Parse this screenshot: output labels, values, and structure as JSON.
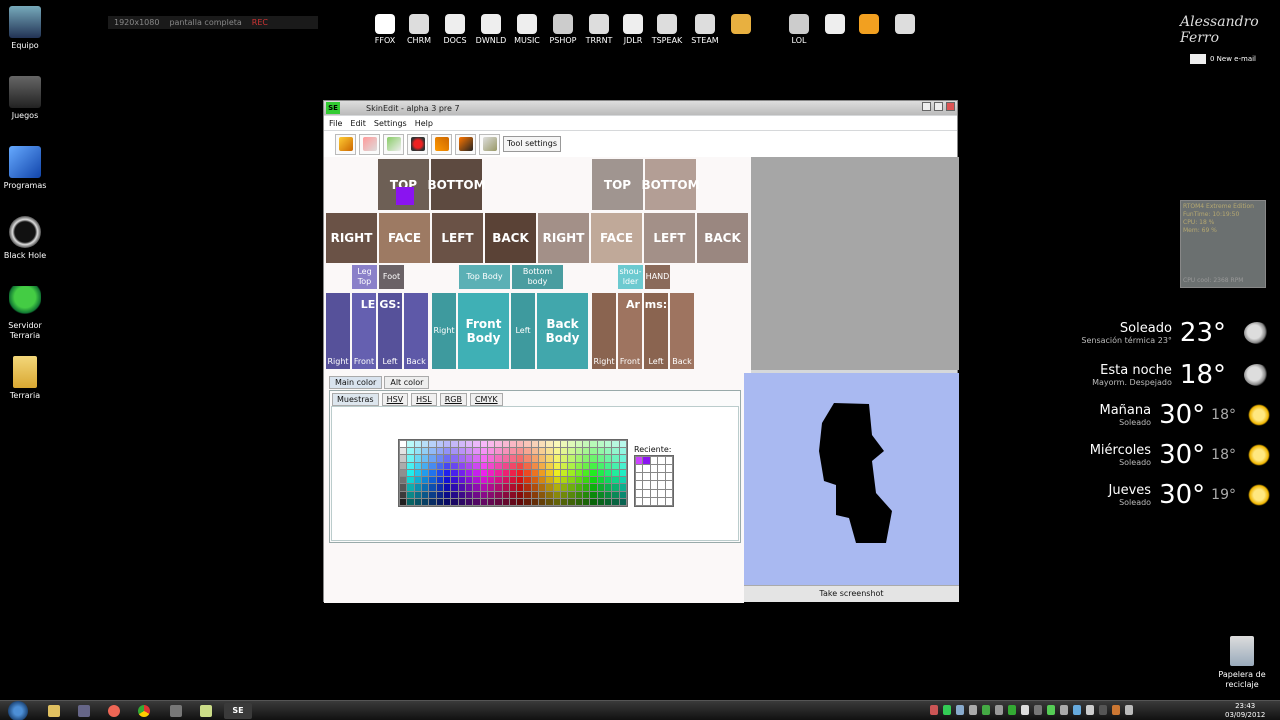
{
  "desktop_icons": [
    {
      "label": "Equipo"
    },
    {
      "label": "Juegos"
    },
    {
      "label": "Programas"
    },
    {
      "label": "Black Hole"
    },
    {
      "label": "Servidor Terraria"
    },
    {
      "label": "Terraria"
    }
  ],
  "recording_bar": {
    "resolution": "1920x1080",
    "mode": "pantalla completa",
    "rec": "REC"
  },
  "launcher": [
    "FFOX",
    "CHRM",
    "DOCS",
    "DWNLD",
    "MUSIC",
    "PSHOP",
    "TRRNT",
    "JDLR",
    "TSPEAK",
    "STEAM",
    "",
    "LOL",
    "",
    "",
    ""
  ],
  "signature": "Alessandro Ferro",
  "mail": "0 New e-mail",
  "cpu_widget": {
    "lines": [
      "RTOM4 Extreme Edition",
      "FunTime: 10:19:50",
      "CPU: 18 %",
      "Mem: 69 %"
    ],
    "fan": "CPU cool: 2368 RPM"
  },
  "weather": [
    {
      "name": "Soleado",
      "sub": "Sensación térmica 23°",
      "temp": "23°",
      "low": "",
      "icon": "moon-cloud-icon"
    },
    {
      "name": "Esta noche",
      "sub": "Mayorm. Despejado",
      "temp": "18°",
      "low": "",
      "icon": "moon-cloud-icon"
    },
    {
      "name": "Mañana",
      "sub": "Soleado",
      "temp": "30°",
      "low": "18°",
      "icon": "sun-icon"
    },
    {
      "name": "Miércoles",
      "sub": "Soleado",
      "temp": "30°",
      "low": "18°",
      "icon": "sun-icon"
    },
    {
      "name": "Jueves",
      "sub": "Soleado",
      "temp": "30°",
      "low": "19°",
      "icon": "sun-icon"
    }
  ],
  "recycle_bin": "Papelera de reciclaje",
  "taskbar": {
    "se_label": "SE",
    "clock_time": "23:43",
    "clock_date": "03/09/2012"
  },
  "window": {
    "logo": "SE",
    "title": "SkinEdit - alpha 3 pre 7",
    "menu": [
      "File",
      "Edit",
      "Settings",
      "Help"
    ],
    "tool_settings": "Tool settings",
    "parts": {
      "top1": "TOP",
      "bottom1": "BOTTOM",
      "top2": "TOP",
      "bottom2": "BOTTOM",
      "right1": "RIGHT",
      "face1": "FACE",
      "left1": "LEFT",
      "back1": "BACK",
      "right2": "RIGHT",
      "face2": "FACE",
      "left2": "LEFT",
      "back2": "BACK",
      "leg_top": "Leg Top",
      "foot": "Foot",
      "top_body": "Top Body",
      "bottom_body": "Bottom body",
      "shoulder": "shou-lder",
      "hand": "HAND",
      "legs1": "LE",
      "legs2": "GS:",
      "leg_right": "Right",
      "leg_front": "Front",
      "leg_left": "Left",
      "leg_back": "Back",
      "body_right": "Right",
      "front_body": "Front Body",
      "body_left": "Left",
      "back_body": "Back Body",
      "arms1": "Ar",
      "arms2": "ms:",
      "arm_right": "Right",
      "arm_front": "Front",
      "arm_left": "Left",
      "arm_back": "Back"
    },
    "color_tabs": [
      "Main color",
      "Alt color"
    ],
    "color_subtabs": [
      "Muestras",
      "HSV",
      "HSL",
      "RGB",
      "CMYK"
    ],
    "recent_label": "Reciente:",
    "screenshot_button": "Take screenshot"
  }
}
